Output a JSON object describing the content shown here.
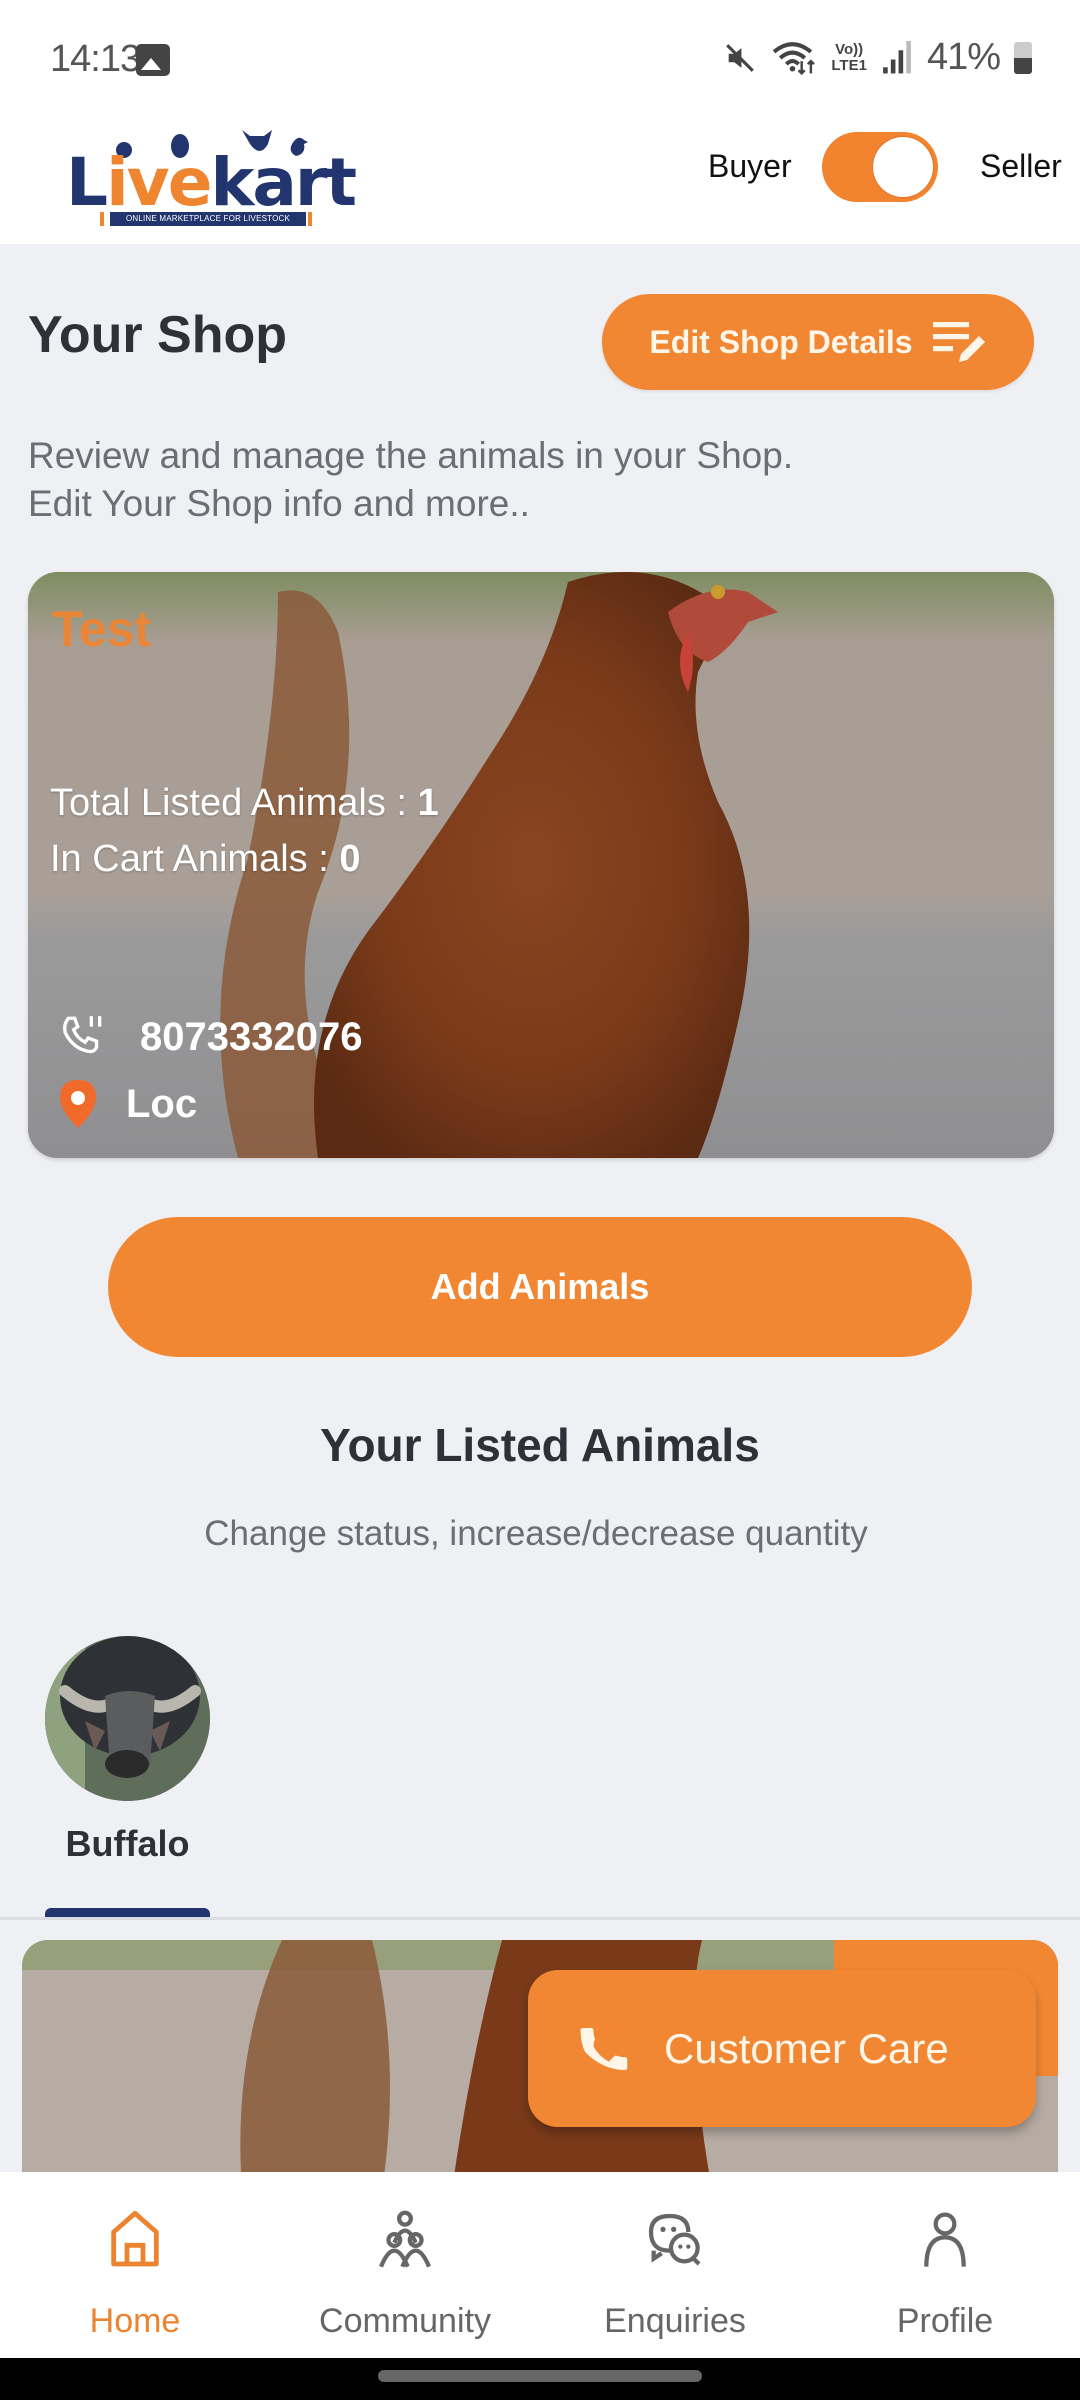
{
  "status_bar": {
    "time": "14:13",
    "battery": "41%",
    "network_label_top": "Vo))",
    "network_label_bottom": "LTE1",
    "icons": [
      "gallery-icon",
      "mute-icon",
      "wifi-icon",
      "volte-icon",
      "signal-icon",
      "battery-icon"
    ]
  },
  "header": {
    "logo": {
      "word_part1": "L",
      "word_part2": "ive",
      "word_part3": "kart",
      "tagline": "ONLINE MARKETPLACE FOR LIVESTOCK"
    },
    "mode_toggle": {
      "left_label": "Buyer",
      "right_label": "Seller",
      "state": "Seller",
      "on": true
    }
  },
  "shop": {
    "title": "Your Shop",
    "edit_button_label": "Edit Shop Details",
    "description_line1": "Review and manage the animals in your Shop.",
    "description_line2": "Edit Your Shop info and more..",
    "card": {
      "shop_name": "Test",
      "total_listed_label": "Total Listed Animals : ",
      "total_listed_value": "1",
      "in_cart_label": "In Cart Animals : ",
      "in_cart_value": "0",
      "phone": "8073332076",
      "location": "Loc"
    },
    "add_animals_label": "Add Animals"
  },
  "listed": {
    "title": "Your Listed Animals",
    "subtitle": "Change status, increase/decrease quantity",
    "tabs": [
      {
        "label": "Buffalo",
        "selected": true
      }
    ]
  },
  "fab": {
    "label": "Customer Care"
  },
  "bottom_nav": {
    "items": [
      {
        "label": "Home",
        "icon": "home-icon",
        "active": true
      },
      {
        "label": "Community",
        "icon": "community-icon",
        "active": false
      },
      {
        "label": "Enquiries",
        "icon": "chat-icon",
        "active": false
      },
      {
        "label": "Profile",
        "icon": "profile-icon",
        "active": false
      }
    ]
  },
  "colors": {
    "accent": "#F28733",
    "navy": "#23356E",
    "background": "#EFF0F4",
    "text_dark": "#2E3138",
    "text_muted": "#6B6E74"
  }
}
